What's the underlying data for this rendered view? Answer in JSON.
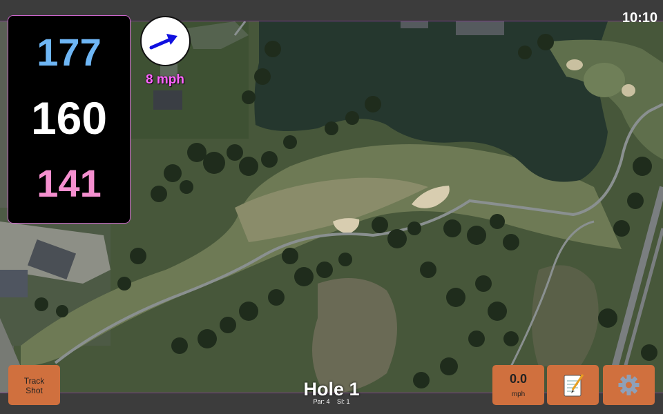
{
  "status_bar": {
    "time": "10:10"
  },
  "yardages": {
    "back": "177",
    "center": "160",
    "front": "141"
  },
  "wind": {
    "speed_text": "8 mph",
    "arrow_icon": "wind-direction-arrow-icon",
    "arrow_color": "#1010e0"
  },
  "buttons": {
    "track_shot": {
      "line1": "Track",
      "line2": "Shot"
    },
    "shot_speed": {
      "value": "0.0",
      "unit": "mph"
    },
    "notes": {
      "icon": "notepad-icon"
    },
    "settings": {
      "icon": "gear-icon"
    }
  },
  "hole": {
    "title": "Hole 1",
    "par_text": "Par: 4",
    "si_text": "SI: 1"
  },
  "colors": {
    "button_orange": "#d0703e",
    "back_yardage": "#6eb6f5",
    "front_yardage": "#f58fcf",
    "wind_text": "#ff66ff",
    "panel_border": "#cc66cc"
  }
}
